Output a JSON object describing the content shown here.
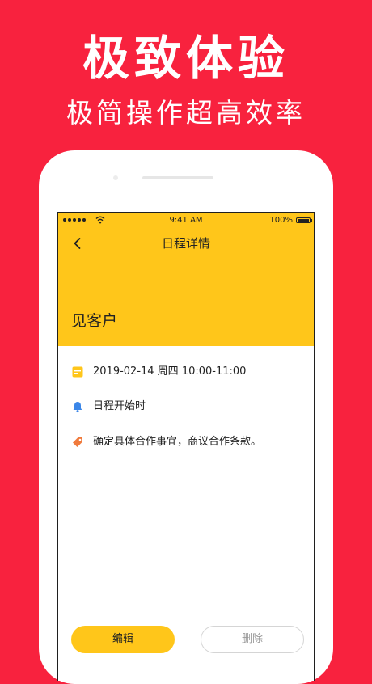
{
  "promo": {
    "headline": "极致体验",
    "subline": "极简操作超高效率"
  },
  "status_bar": {
    "time": "9:41 AM",
    "battery": "100%"
  },
  "nav": {
    "title": "日程详情"
  },
  "event": {
    "title": "见客户",
    "datetime": "2019-02-14 周四 10:00-11:00",
    "reminder": "日程开始时",
    "note": "确定具体合作事宜，商议合作条款。"
  },
  "actions": {
    "edit_label": "编辑",
    "delete_label": "删除"
  },
  "colors": {
    "background": "#f8223e",
    "accent": "#ffc61a",
    "bell": "#3a86e8",
    "tag": "#f07a3c"
  },
  "icons": {
    "back": "chevron-left-icon",
    "calendar": "calendar-icon",
    "reminder": "bell-icon",
    "note": "tag-icon"
  }
}
